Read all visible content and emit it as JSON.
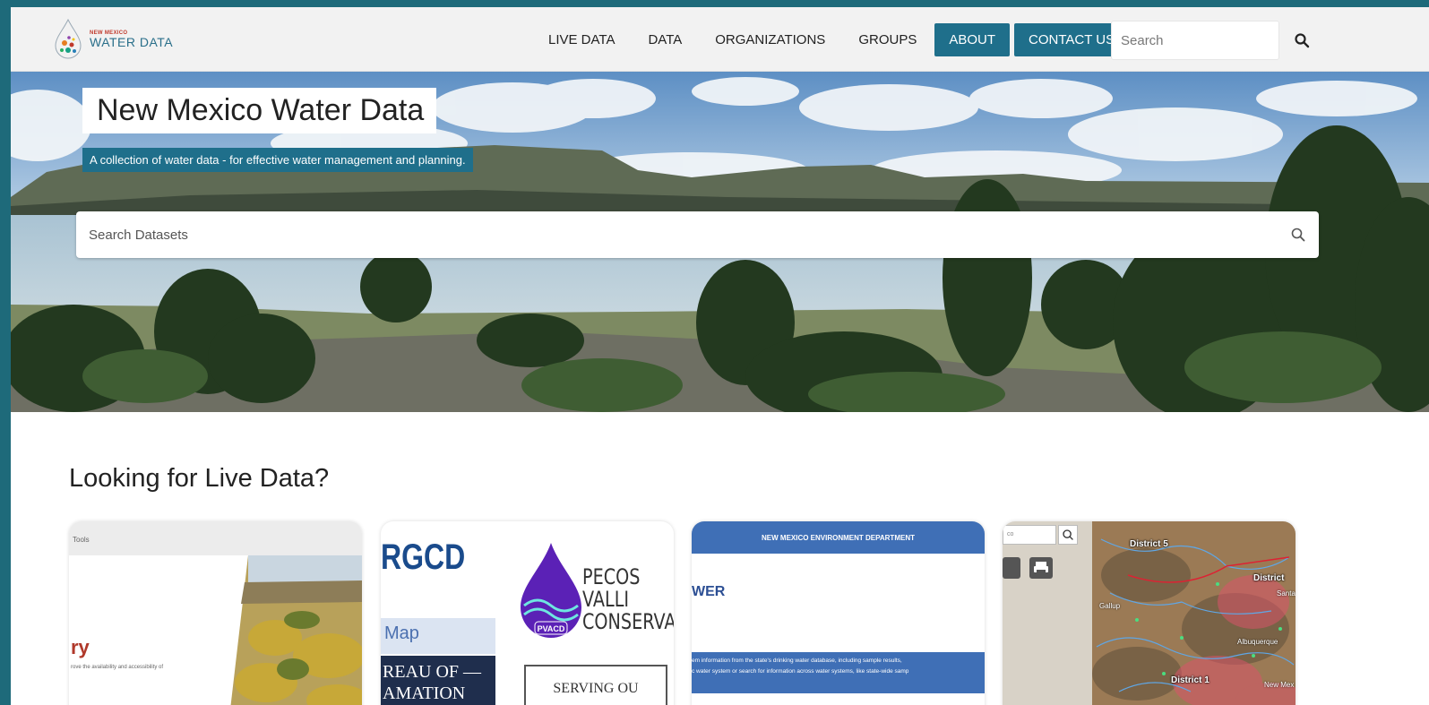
{
  "header": {
    "logo": {
      "small_text": "NEW MEXICO",
      "big_text": "WATER DATA"
    },
    "nav_links": [
      "LIVE DATA",
      "DATA",
      "ORGANIZATIONS",
      "GROUPS"
    ],
    "nav_buttons": [
      "ABOUT",
      "CONTACT US"
    ],
    "search": {
      "placeholder": "Search",
      "icon": "search-icon"
    }
  },
  "hero": {
    "title": "New Mexico Water Data",
    "subtitle": "A collection of water data - for effective water management and planning.",
    "search": {
      "placeholder": "Search Datasets",
      "icon": "search-icon"
    }
  },
  "live_data": {
    "heading": "Looking for Live Data?",
    "cards": [
      {
        "tools_label": "Tools",
        "title_fragment": "ry",
        "desc_fragment": "rove the availability and accessibility of"
      },
      {
        "rgcd_text": "RGCD",
        "pecos_line1": "PECOS VALLI",
        "pecos_line2": "CONSERVAN",
        "pvacd_text": "PVACD",
        "map_text": "Map",
        "bureau_line1": "REAU OF —",
        "bureau_line2": "AMATION",
        "serving_text": "SERVING OU"
      },
      {
        "dept_text": "NEW MEXICO ENVIRONMENT DEPARTMENT",
        "wer_text": "WER",
        "info_line1": "em information from the state's drinking water database, including sample results,",
        "info_line2": "c water system or search for information across water systems, like state-wide samp"
      },
      {
        "search_text": "co",
        "districts": [
          "District 5",
          "District",
          "District 1"
        ],
        "cities": [
          "Gallup",
          "Albuquerque",
          "New Mex",
          "Santa"
        ]
      }
    ]
  },
  "colors": {
    "brand_teal": "#1f6f8b",
    "nmed_blue": "#3f6fb6"
  }
}
